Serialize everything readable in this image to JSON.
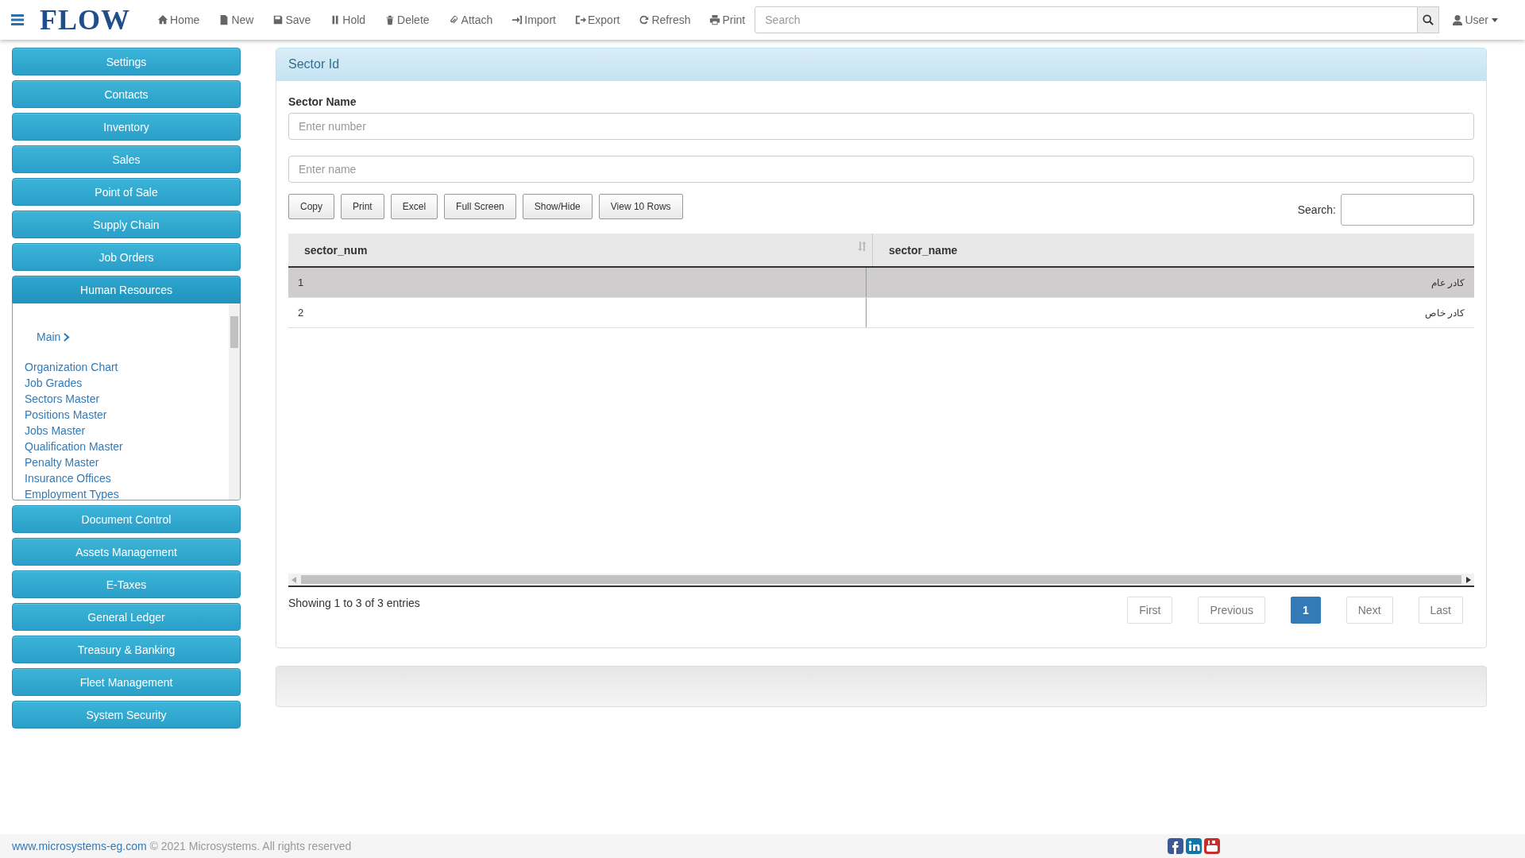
{
  "logo": "FLOW",
  "toolbar": [
    {
      "label": "Home"
    },
    {
      "label": "New"
    },
    {
      "label": "Save"
    },
    {
      "label": "Hold"
    },
    {
      "label": "Delete"
    },
    {
      "label": "Attach"
    },
    {
      "label": "Import"
    },
    {
      "label": "Export"
    },
    {
      "label": "Refresh"
    },
    {
      "label": "Print"
    }
  ],
  "search": {
    "placeholder": "Search"
  },
  "user_menu": {
    "label": "User"
  },
  "sidebar": {
    "modules": [
      {
        "label": "Settings",
        "expanded": false
      },
      {
        "label": "Contacts",
        "expanded": false
      },
      {
        "label": "Inventory",
        "expanded": false
      },
      {
        "label": "Sales",
        "expanded": false
      },
      {
        "label": "Point of Sale",
        "expanded": false
      },
      {
        "label": "Supply Chain",
        "expanded": false
      },
      {
        "label": "Job Orders",
        "expanded": false
      },
      {
        "label": "Human Resources",
        "expanded": true,
        "submenu": {
          "header": "Main",
          "items": [
            "Organization Chart",
            "Job Grades",
            "Sectors Master",
            "Positions Master",
            "Jobs Master",
            "Qualification Master",
            "Penalty Master",
            "Insurance Offices",
            "Employment Types"
          ]
        }
      },
      {
        "label": "Document Control",
        "expanded": false
      },
      {
        "label": "Assets Management",
        "expanded": false
      },
      {
        "label": "E-Taxes",
        "expanded": false
      },
      {
        "label": "General Ledger",
        "expanded": false
      },
      {
        "label": "Treasury & Banking",
        "expanded": false
      },
      {
        "label": "Fleet Management",
        "expanded": false
      },
      {
        "label": "System Security",
        "expanded": false
      }
    ]
  },
  "panel": {
    "title": "Sector Id",
    "field_label": "Sector Name",
    "fields": [
      {
        "placeholder": "Enter number"
      },
      {
        "placeholder": "Enter name"
      }
    ],
    "buttons": [
      "Copy",
      "Print",
      "Excel",
      "Full Screen",
      "Show/Hide",
      "View 10 Rows"
    ],
    "table_search": {
      "label": "Search:"
    },
    "table": {
      "columns": [
        "sector_num",
        "sector_name"
      ],
      "rows": [
        {
          "cells": [
            "1",
            "كادر عام"
          ],
          "selected": true
        },
        {
          "cells": [
            "2",
            "كادر خاص"
          ],
          "selected": false
        }
      ]
    },
    "info": "Showing 1 to 3 of 3 entries",
    "pagination": [
      {
        "label": "First",
        "selected": false
      },
      {
        "label": "Previous",
        "selected": false
      },
      {
        "label": "1",
        "selected": true
      },
      {
        "label": "Next",
        "selected": false
      },
      {
        "label": "Last",
        "selected": false
      }
    ]
  },
  "footer": {
    "link": "www.microsystems-eg.com",
    "text": "© 2021 Microsystems. All rights reserved"
  }
}
